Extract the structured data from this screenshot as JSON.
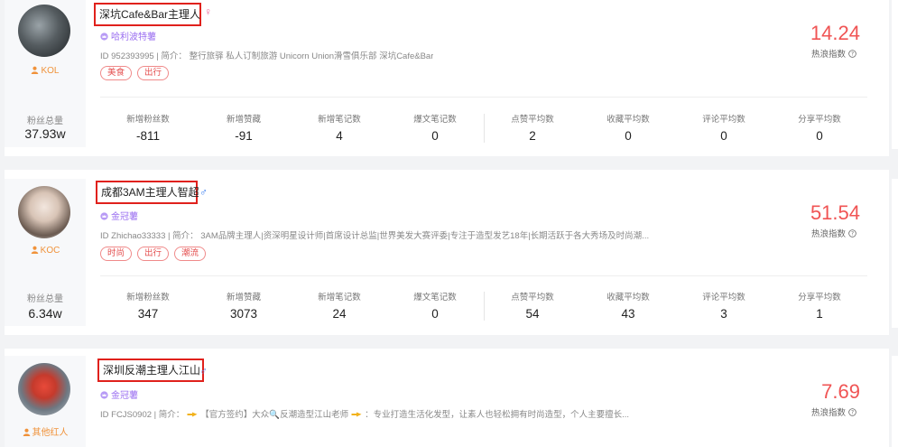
{
  "cards": [
    {
      "name": "深坑Cafe&Bar主理人",
      "gender": "♀",
      "role": "KOL",
      "badge": "哈利波特薯",
      "bio": "ID 952393995 | 简介：  整行旅驿 私人订制旅游 Unicorn Union滑雪俱乐部 深坑Cafe&Bar",
      "tags": [
        "美食",
        "出行"
      ],
      "score": "14.24",
      "score_label": "热浪指数",
      "fans_label": "粉丝总量",
      "fans_value": "37.93w",
      "stats": [
        {
          "label": "新增粉丝数",
          "value": "-811"
        },
        {
          "label": "新增赞藏",
          "value": "-91"
        },
        {
          "label": "新增笔记数",
          "value": "4"
        },
        {
          "label": "爆文笔记数",
          "value": "0"
        },
        {
          "label": "点赞平均数",
          "value": "2"
        },
        {
          "label": "收藏平均数",
          "value": "0"
        },
        {
          "label": "评论平均数",
          "value": "0"
        },
        {
          "label": "分享平均数",
          "value": "0"
        }
      ]
    },
    {
      "name": "成都3AM主理人智超",
      "gender": "♂",
      "role": "KOC",
      "badge": "金冠薯",
      "bio": "ID Zhichao33333 | 简介：  3AM品牌主理人|资深明星设计师|首席设计总监|世界美发大赛评委|专注于造型发艺18年|长期活跃于各大秀场及时尚潮...",
      "tags": [
        "时尚",
        "出行",
        "潮流"
      ],
      "score": "51.54",
      "score_label": "热浪指数",
      "fans_label": "粉丝总量",
      "fans_value": "6.34w",
      "stats": [
        {
          "label": "新增粉丝数",
          "value": "347"
        },
        {
          "label": "新增赞藏",
          "value": "3073"
        },
        {
          "label": "新增笔记数",
          "value": "24"
        },
        {
          "label": "爆文笔记数",
          "value": "0"
        },
        {
          "label": "点赞平均数",
          "value": "54"
        },
        {
          "label": "收藏平均数",
          "value": "43"
        },
        {
          "label": "评论平均数",
          "value": "3"
        },
        {
          "label": "分享平均数",
          "value": "1"
        }
      ]
    },
    {
      "name": "深圳反潮主理人江山",
      "gender": "♂",
      "role": "其他红人",
      "badge": "金冠薯",
      "bio_prefix": "ID FCJS0902 | 简介：",
      "bio_mid": "【官方签约】大众🔍反潮造型江山老师",
      "bio_suffix": "：专业打造生活化发型，让素人也轻松拥有时尚造型，个人主要擅长...",
      "score": "7.69",
      "score_label": "热浪指数"
    }
  ],
  "colors": {
    "score": "#f05454",
    "highlight_box": "#e0211c",
    "role": "#f0923a",
    "badge": "#9a6ef0",
    "tag": "#e45050"
  }
}
